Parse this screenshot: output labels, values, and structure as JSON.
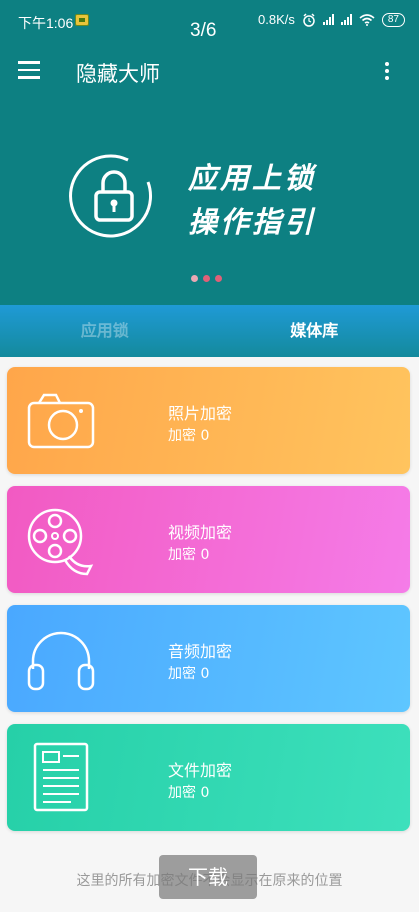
{
  "status_bar": {
    "time": "下午1:06",
    "counter": "3/6",
    "network_speed": "0.8K/s",
    "battery": "87",
    "icons": [
      "alarm-icon",
      "signal-hd-icon",
      "signal-icon",
      "wifi-icon",
      "battery-icon"
    ]
  },
  "app_bar": {
    "title": "隐藏大师",
    "menu_icon": "hamburger-menu-icon",
    "more_icon": "more-vertical-icon"
  },
  "banner": {
    "line1": "应用上锁",
    "line2": "操作指引",
    "icon": "lock-icon",
    "page_count": 3,
    "active_page": 1
  },
  "tabs": [
    {
      "label": "应用锁",
      "active": false
    },
    {
      "label": "媒体库",
      "active": true
    }
  ],
  "cards": [
    {
      "title": "照片加密",
      "count": "加密 0",
      "icon": "camera-icon",
      "color_start": "#ffa64a",
      "color_end": "#ffc45e"
    },
    {
      "title": "视频加密",
      "count": "加密 0",
      "icon": "film-reel-icon",
      "color_start": "#f25ac2",
      "color_end": "#f57ce8"
    },
    {
      "title": "音频加密",
      "count": "加密 0",
      "icon": "headphones-icon",
      "color_start": "#4aa8ff",
      "color_end": "#5ec6ff"
    },
    {
      "title": "文件加密",
      "count": "加密 0",
      "icon": "document-icon",
      "color_start": "#26d0a8",
      "color_end": "#3de0bc"
    }
  ],
  "footer": {
    "note": "这里的所有加密文件不会显示在原来的位置",
    "download_label": "下载"
  },
  "colors": {
    "primary": "#0d8082",
    "tab_bar": "#1f9ad6"
  }
}
